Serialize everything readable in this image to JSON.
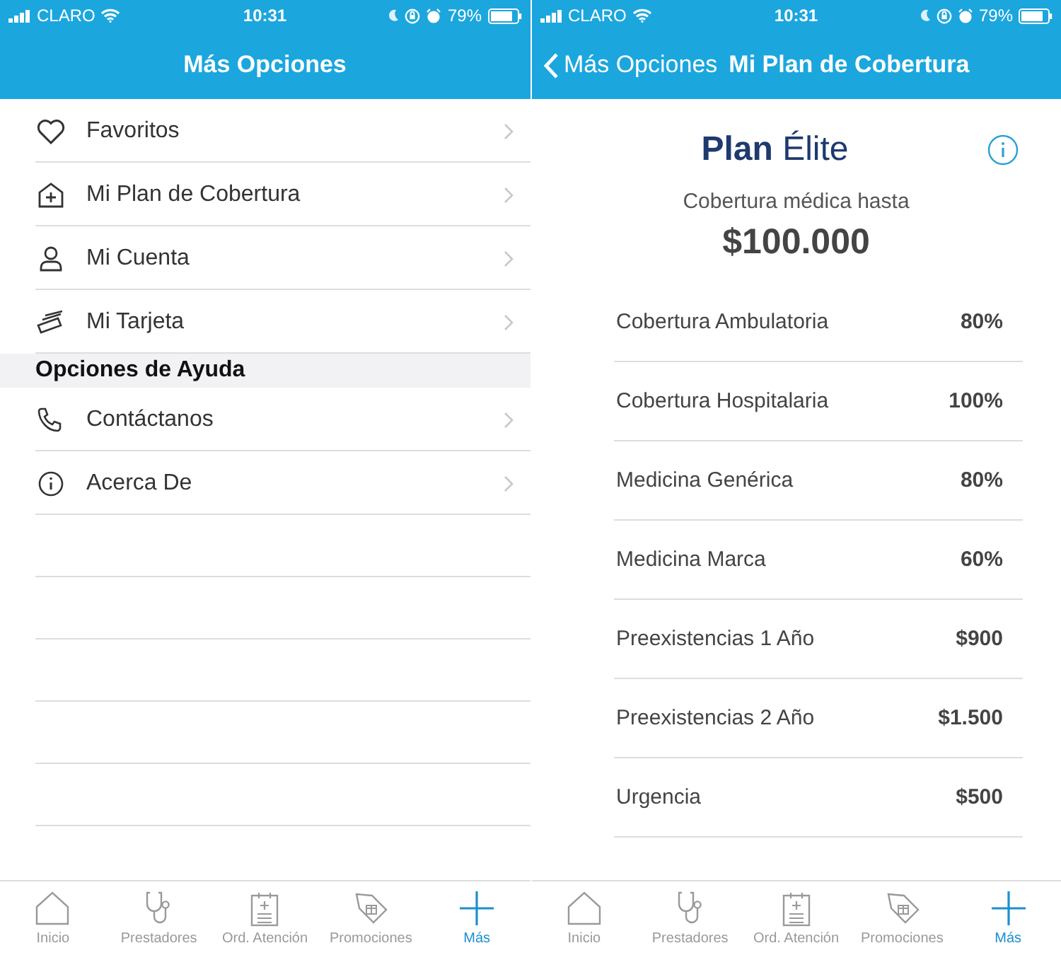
{
  "menu_screen": {
    "status_bar": {
      "carrier": "CLARO",
      "time": "10:31",
      "battery": "79%"
    },
    "nav_bar": {
      "title": "Más Opciones"
    },
    "sections": [
      {
        "items": [
          {
            "label": "Favoritos"
          },
          {
            "label": "Mi Plan de Cobertura"
          },
          {
            "label": "Mi Cuenta"
          },
          {
            "label": "Mi Tarjeta"
          }
        ]
      },
      {
        "header": "Opciones de Ayuda",
        "items": [
          {
            "label": "Contáctanos"
          },
          {
            "label": "Acerca De"
          }
        ]
      }
    ],
    "tab_bar": [
      {
        "label": "Inicio",
        "selected": false
      },
      {
        "label": "Prestadores",
        "selected": false
      },
      {
        "label": "Ord. Atención",
        "selected": false
      },
      {
        "label": "Promociones",
        "selected": false
      },
      {
        "label": "Más",
        "selected": true
      }
    ]
  },
  "plan_screen": {
    "status_bar": {
      "carrier": "CLARO",
      "time": "10:31",
      "battery": "79%"
    },
    "nav_bar": {
      "back": "Más Opciones",
      "title": "Mi Plan de Cobertura"
    },
    "plan_name": "**Plan** Élite",
    "coverage_label": "Cobertura médica hasta",
    "coverage_amount": "$100.000",
    "benefits": [
      {
        "name": "Cobertura Ambulatoria",
        "value": "80%"
      },
      {
        "name": "Cobertura Hospitalaria",
        "value": "100%"
      },
      {
        "name": "Medicina Genérica",
        "value": "80%"
      },
      {
        "name": "Medicina Marca",
        "value": "60%"
      },
      {
        "name": "Preexistencias 1 Año",
        "value": "$900"
      },
      {
        "name": "Preexistencias 2 Año",
        "value": "$1.500"
      },
      {
        "name": "Urgencia",
        "value": "$500"
      }
    ],
    "tab_bar": [
      {
        "label": "Inicio",
        "selected": false
      },
      {
        "label": "Prestadores",
        "selected": false
      },
      {
        "label": "Ord. Atención",
        "selected": false
      },
      {
        "label": "Promociones",
        "selected": false
      },
      {
        "label": "Más",
        "selected": true
      }
    ]
  }
}
